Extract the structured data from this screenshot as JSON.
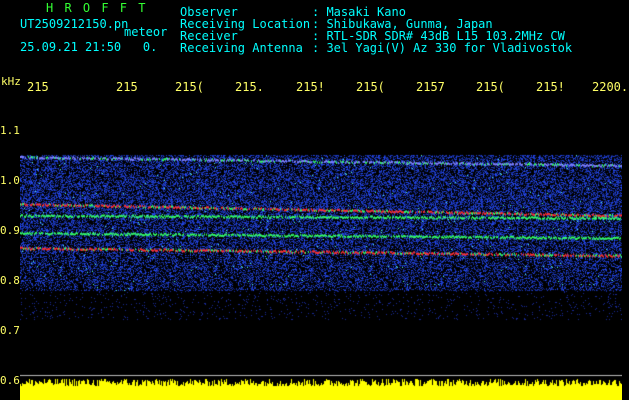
{
  "header": {
    "title": "H R O F F T",
    "filename": "UT2509212150.pn",
    "mode": "meteor",
    "date": "25.09.21 21:50",
    "status": "0."
  },
  "meta": [
    {
      "label": "Observer",
      "value": ": Masaki Kano"
    },
    {
      "label": "Receiving Location",
      "value": ": Shibukawa, Gunma, Japan"
    },
    {
      "label": "Receiver",
      "value": ": RTL-SDR SDR# 43dB L15 103.2MHz CW"
    },
    {
      "label": "Receiving Antenna",
      "value": ": 3el Yagi(V) Az 330 for Vladivostok"
    }
  ],
  "colors": {
    "background": "#000000",
    "text_header": "#00ffff",
    "title": "#33ff33",
    "axis_text": "#ffff66",
    "noise_blue": "#1e3cff",
    "signal_green": "#33ff66",
    "signal_red": "#ff3030",
    "power_yellow": "#ffff00"
  },
  "chart_data": {
    "type": "heatmap",
    "y_unit": "kHz",
    "xtick_labels": [
      "215",
      "215",
      "215(",
      "215.",
      "215!",
      "215(",
      "2157",
      "215(",
      "215!",
      "2200."
    ],
    "ytick_labels": [
      "1.1",
      "1.0",
      "0.9",
      "0.8",
      "0.7",
      "0.6"
    ],
    "ytick_values": [
      1.1,
      1.0,
      0.9,
      0.8,
      0.7,
      0.6
    ],
    "ylim": [
      0.6,
      1.1
    ],
    "noise_band": [
      0.78,
      1.05
    ],
    "traces": [
      {
        "y_start": 1.047,
        "y_end": 1.03,
        "color": "#8080ff"
      },
      {
        "y_start": 0.953,
        "y_end": 0.93,
        "color": "#ff3030"
      },
      {
        "y_start": 0.93,
        "y_end": 0.925,
        "color": "#33ff66"
      },
      {
        "y_start": 0.895,
        "y_end": 0.885,
        "color": "#33ff66"
      },
      {
        "y_start": 0.865,
        "y_end": 0.85,
        "color": "#ff3030"
      }
    ]
  }
}
